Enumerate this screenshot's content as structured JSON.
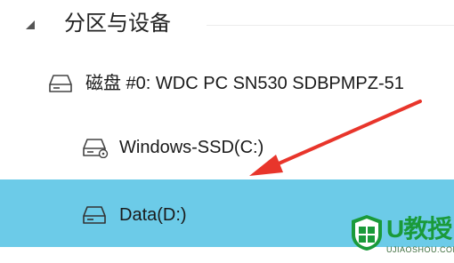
{
  "section": {
    "title": "分区与设备",
    "collapse_icon": "collapse-triangle-icon"
  },
  "tree": {
    "disk": {
      "label": "磁盘 #0: WDC PC SN530 SDBPMPZ-51",
      "icon": "hard-drive-icon"
    },
    "partitions": [
      {
        "label": "Windows-SSD(C:)",
        "icon": "system-drive-icon",
        "selected": false
      },
      {
        "label": "Data(D:)",
        "icon": "drive-icon",
        "selected": true
      }
    ]
  },
  "annotation": {
    "arrow_color": "#e8352b"
  },
  "watermark": {
    "brand": "U教授",
    "url": "UJIAOSHOU.COM",
    "color": "#1a9a3a"
  },
  "colors": {
    "selected_row": "#6ccbe8",
    "background": "#ffffff"
  }
}
